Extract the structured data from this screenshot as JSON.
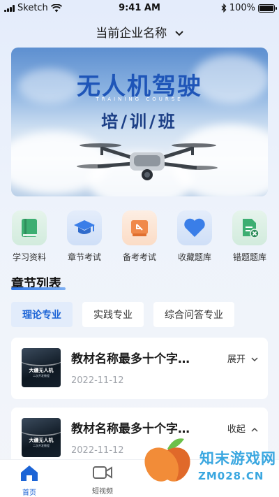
{
  "status_bar": {
    "carrier": "Sketch",
    "time": "9:41 AM",
    "battery": "100%"
  },
  "header": {
    "title": "当前企业名称"
  },
  "banner": {
    "title": "无人机驾驶",
    "subtitle": "TRAINING COURSE",
    "course": "培/训/班"
  },
  "quick_links": [
    {
      "label": "学习资料",
      "icon": "book-icon",
      "color": "#3dae72"
    },
    {
      "label": "章节考试",
      "icon": "graduation-cap-icon",
      "color": "#3a7ee8"
    },
    {
      "label": "备考考试",
      "icon": "exam-paper-icon",
      "color": "#f0894a"
    },
    {
      "label": "收藏题库",
      "icon": "heart-icon",
      "color": "#3a7ee8"
    },
    {
      "label": "错题题库",
      "icon": "error-document-icon",
      "color": "#3dae72"
    }
  ],
  "section": {
    "title": "章节列表"
  },
  "tabs": [
    {
      "label": "理论专业",
      "active": true
    },
    {
      "label": "实践专业",
      "active": false
    },
    {
      "label": "综合问答专业",
      "active": false
    }
  ],
  "cards": [
    {
      "title": "教材名称最多十个字…",
      "date": "2022-11-12",
      "action": "展开",
      "cover_title": "大疆无人机",
      "cover_sub": "二次开发教程"
    },
    {
      "title": "教材名称最多十个字…",
      "date": "2022-11-12",
      "action": "收起",
      "cover_title": "大疆无人机",
      "cover_sub": "二次开发教程"
    }
  ],
  "bottom_nav": [
    {
      "label": "首页",
      "active": true
    },
    {
      "label": "短视频",
      "active": false
    }
  ],
  "watermark": {
    "text": "知末游戏网",
    "url": "ZM028.CN"
  },
  "colors": {
    "accent": "#1c64d6",
    "tab_active_bg": "#e2ecfb"
  }
}
